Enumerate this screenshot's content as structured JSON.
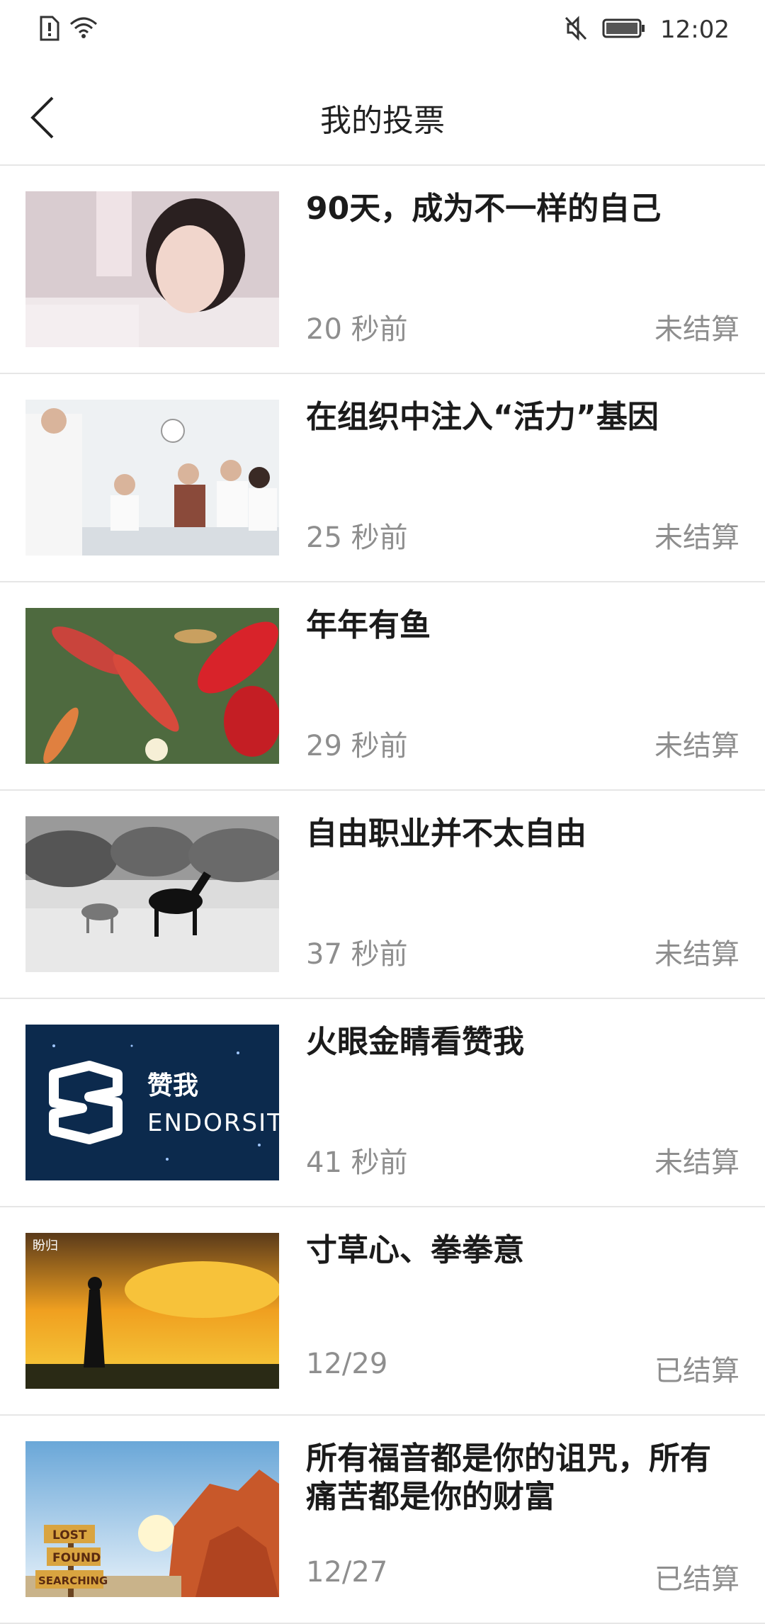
{
  "status_bar": {
    "time": "12:02"
  },
  "header": {
    "title": "我的投票"
  },
  "votes": [
    {
      "title": "90天，成为不一样的自己",
      "time": "20 秒前",
      "status": "未结算"
    },
    {
      "title": "在组织中注入“活力”基因",
      "time": "25 秒前",
      "status": "未结算"
    },
    {
      "title": "年年有鱼",
      "time": "29 秒前",
      "status": "未结算"
    },
    {
      "title": "自由职业并不太自由",
      "time": "37 秒前",
      "status": "未结算"
    },
    {
      "title": "火眼金睛看赞我",
      "time": "41 秒前",
      "status": "未结算",
      "image_text": [
        "赞我",
        "ENDORSIT"
      ]
    },
    {
      "title": "寸草心、拳拳意",
      "time": "12/29",
      "status": "已结算",
      "image_text": [
        "盼归"
      ]
    },
    {
      "title": "所有福音都是你的诅咒，所有痛苦都是你的财富",
      "time": "12/27",
      "status": "已结算",
      "image_text": [
        "LOST",
        "FOUND",
        "SEARCHING"
      ]
    }
  ]
}
